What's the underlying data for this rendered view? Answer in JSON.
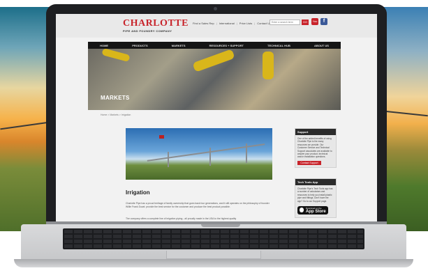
{
  "site": {
    "logo_main": "CHARLOTTE",
    "logo_sub": "PIPE AND FOUNDRY COMPANY",
    "top_links": [
      "Find a Sales Rep",
      "International",
      "Price Lists",
      "Contact Us"
    ],
    "search_placeholder": "Enter a search term",
    "search_button": "GO",
    "youtube_label": "You",
    "facebook_label": "f"
  },
  "nav": {
    "items": [
      "HOME",
      "PRODUCTS",
      "MARKETS",
      "RESOURCES + SUPPORT",
      "TECHNICAL HUB",
      "ABOUT US"
    ]
  },
  "hero": {
    "title": "MARKETS"
  },
  "breadcrumb": "Home > Markets > Irrigation",
  "main": {
    "heading": "Irrigation",
    "para1": "Charlotte Pipe has a proud heritage of family ownership that goes back four generations, and it still operates on the philosophy of founder Willie Frank Dowd: provide the best service for the customer and produce the best product possible.",
    "para2": "The company offers a complete line of irrigation piping - all proudly made in the USA to the highest quality"
  },
  "sidebar": {
    "support": {
      "title": "Support",
      "text": "One of the added benefits of using Charlotte Pipe is the many resources we provide. Our Customer Service and Technical Support associates are available to answer your product, technical and/or installation questions.",
      "button": "Contact Support"
    },
    "app": {
      "title": "Tech Tools App",
      "text": "Charlotte Pipe's Tech Tools app has a number of calculators and resources to help you install plastic pipe and fittings. Don't have the app? Go to our Support page.",
      "badge_small": "Download on the",
      "badge_big": "App Store"
    }
  },
  "colors": {
    "brand_red": "#c8242b",
    "nav_bg": "#151515",
    "facebook": "#3b5998"
  }
}
